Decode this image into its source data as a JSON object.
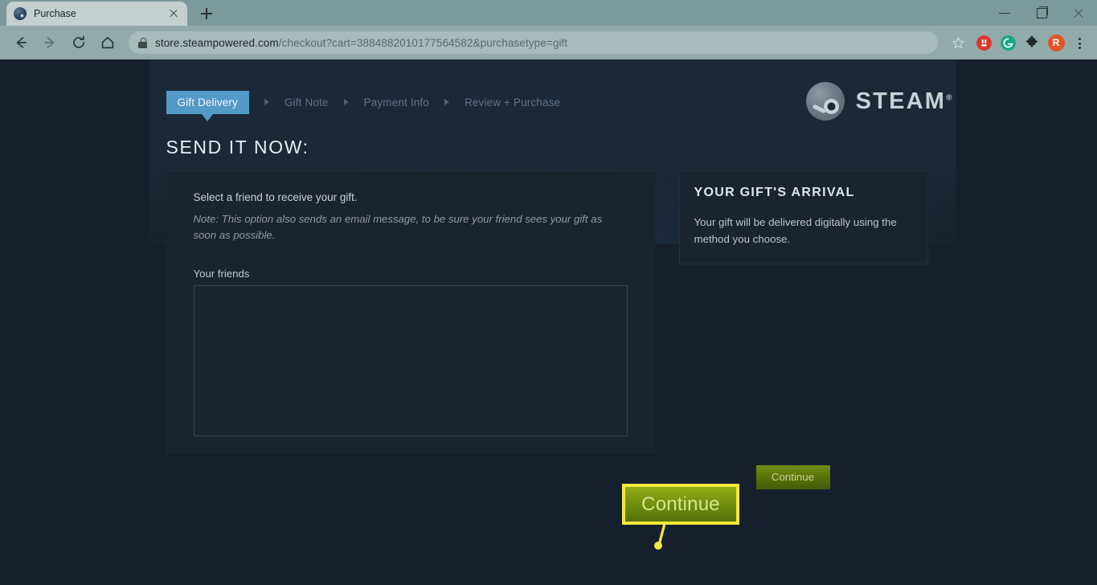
{
  "browser": {
    "tab": {
      "title": "Purchase",
      "favicon": "steam-favicon",
      "close": "×"
    },
    "newtab_label": "+",
    "window_controls": {
      "minimize": "—",
      "maximize": "❐",
      "close": "✕"
    },
    "nav": {
      "back": "←",
      "forward": "→",
      "reload": "⟳",
      "home": "⌂"
    },
    "omnibox": {
      "lock": "secure-lock",
      "url_host": "store.steampowered.com",
      "url_path": "/checkout?cart=3884882010177564582&purchasetype=gift",
      "url_full": "store.steampowered.com/checkout?cart=3884882010177564582&purchasetype=gift"
    },
    "actions": {
      "bookmark": "☆",
      "adblock": "adblock-extension-icon",
      "grammarly": "grammarly-extension-icon",
      "extensions": "puzzle-piece-icon",
      "profile_initial": "R",
      "menu": "⋮"
    },
    "colors": {
      "chrome_bg": "#93aaaa",
      "tab_active_bg": "#c3d0ce",
      "omnibox_bg": "#a7bbbb",
      "adblock": "#d9352c",
      "grammarly": "#15a886",
      "extensions": "#1c2b27",
      "avatar": "#e2552b"
    }
  },
  "steam": {
    "logo": {
      "mark": "steam-logo-icon",
      "word": "STEAM",
      "registered": "®"
    },
    "breadcrumb": [
      {
        "label": "Gift Delivery",
        "active": true
      },
      {
        "label": "Gift Note",
        "active": false
      },
      {
        "label": "Payment Info",
        "active": false
      },
      {
        "label": "Review + Purchase",
        "active": false
      }
    ],
    "page_title": "SEND IT NOW:",
    "form": {
      "lead": "Select a friend to receive your gift.",
      "note": "Note: This option also sends an email message, to be sure your friend sees your gift as soon as possible.",
      "friends_label": "Your friends",
      "friends_items": []
    },
    "sidebar": {
      "heading": "YOUR GIFT'S ARRIVAL",
      "body": "Your gift will be delivered digitally using the method you choose."
    },
    "continue_button": "Continue",
    "colors": {
      "page_bg": "#16202d",
      "header_bg": "#1b2838",
      "panel_bg": "#1a2330",
      "accent_blue": "#539ac7",
      "button_green": "#5c7408"
    }
  },
  "annotation": {
    "callout_label": "Continue",
    "border_color": "#f3e93c",
    "leader_color": "#f3e93c"
  }
}
